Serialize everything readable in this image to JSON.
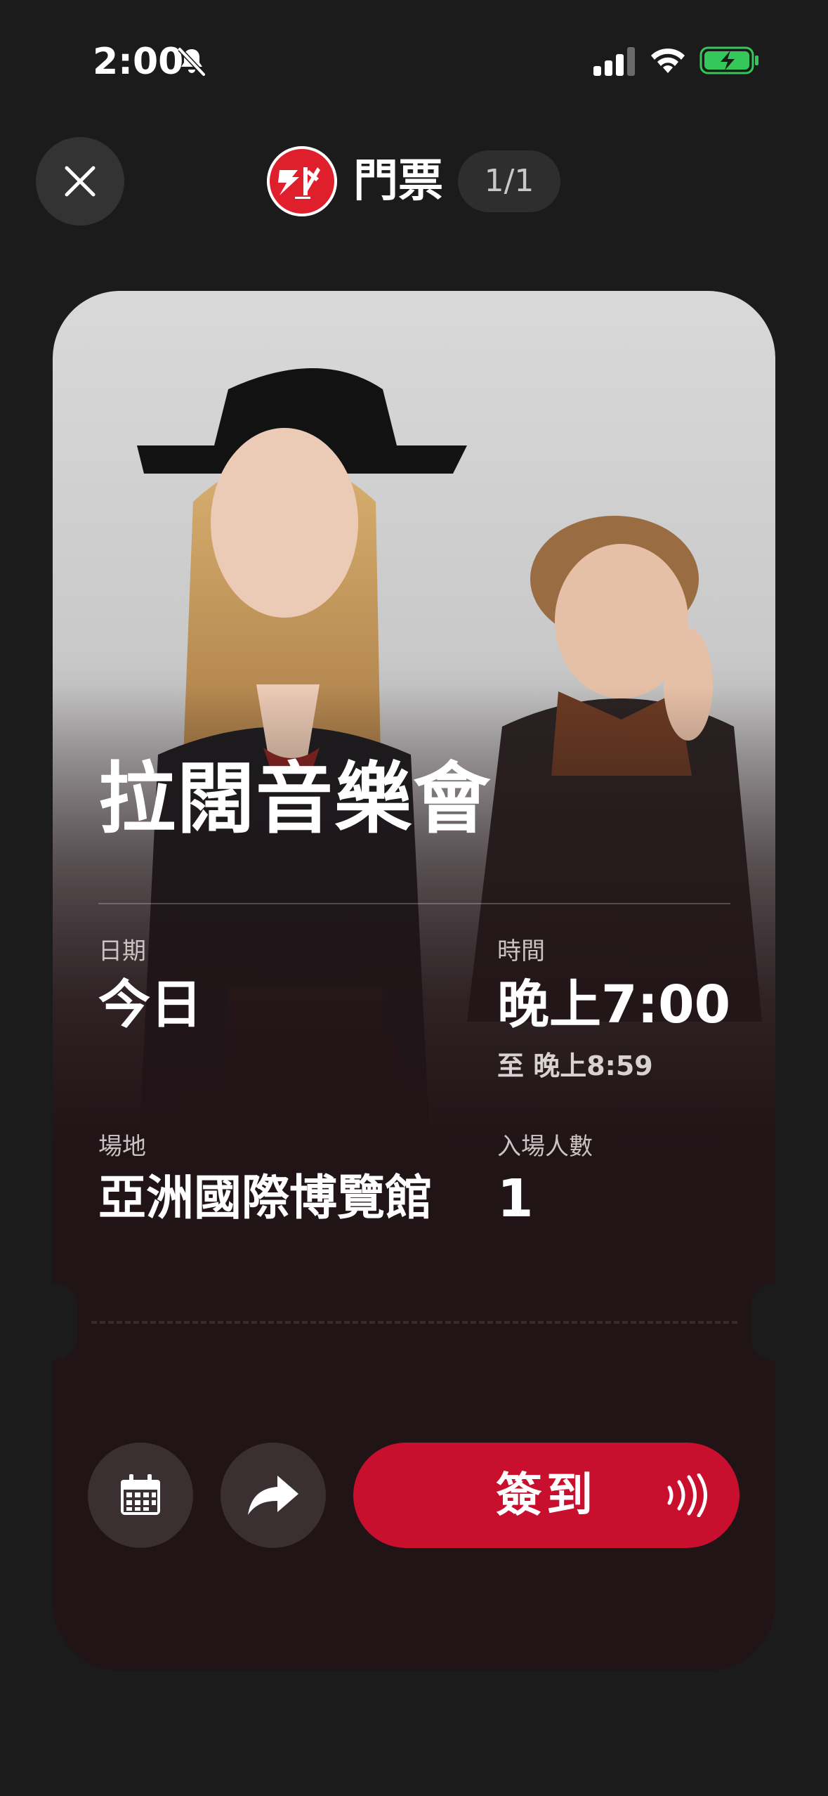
{
  "status_bar": {
    "time": "2:00"
  },
  "header": {
    "title": "門票",
    "page_indicator": "1/1"
  },
  "ticket": {
    "event_title": "拉闊音樂會",
    "date": {
      "label": "日期",
      "value": "今日"
    },
    "time": {
      "label": "時間",
      "value": "晚上7:00",
      "end": "至 晚上8:59"
    },
    "venue": {
      "label": "場地",
      "value": "亞洲國際博覽館"
    },
    "admission": {
      "label": "入場人數",
      "value": "1"
    }
  },
  "actions": {
    "checkin_label": "簽到"
  },
  "colors": {
    "background": "#1b1b1b",
    "ticket_bg": "#211417",
    "accent": "#c8102e",
    "battery_green": "#34c759"
  },
  "icons": [
    "close-icon",
    "bell-slash-icon",
    "signal-icon",
    "wifi-icon",
    "battery-charging-icon",
    "calendar-icon",
    "share-icon",
    "nfc-icon"
  ]
}
